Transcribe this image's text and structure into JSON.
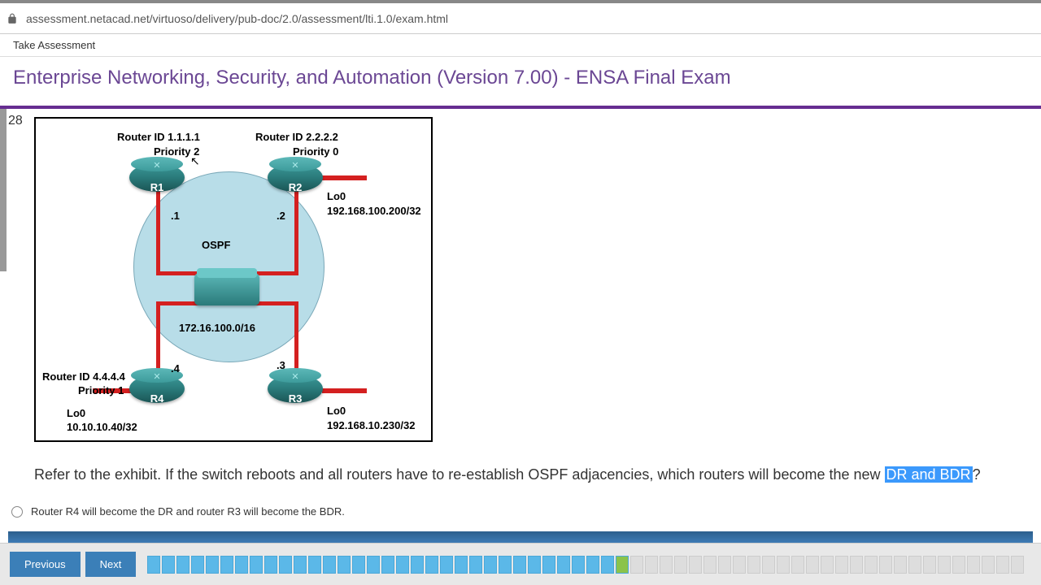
{
  "browser": {
    "url": "assessment.netacad.net/virtuoso/delivery/pub-doc/2.0/assessment/lti.1.0/exam.html"
  },
  "header": {
    "take_assessment": "Take Assessment",
    "exam_title": "Enterprise Networking, Security, and Automation (Version 7.00) - ENSA Final Exam"
  },
  "question": {
    "number": "28",
    "text_before": "Refer to the exhibit. If the switch reboots and all routers have to re-establish OSPF adjacencies, which routers will become the new ",
    "highlighted": "DR and BDR",
    "text_after": "?",
    "option1": "Router R4 will become the DR and router R3 will become the BDR."
  },
  "diagram": {
    "r1_id": "Router ID 1.1.1.1",
    "r1_priority": "Priority 2",
    "r1_label": "R1",
    "r1_dot": ".1",
    "r2_id": "Router ID 2.2.2.2",
    "r2_priority": "Priority 0",
    "r2_label": "R2",
    "r2_dot": ".2",
    "r2_lo": "Lo0",
    "r2_lo_ip": "192.168.100.200/32",
    "r3_label": "R3",
    "r3_dot": ".3",
    "r3_lo": "Lo0",
    "r3_lo_ip": "192.168.10.230/32",
    "r4_id": "Router ID 4.4.4.4",
    "r4_priority": "Priority 1",
    "r4_label": "R4",
    "r4_dot": ".4",
    "r4_lo": "Lo0",
    "r4_lo_ip": "10.10.10.40/32",
    "ospf": "OSPF",
    "subnet": "172.16.100.0/16"
  },
  "footer": {
    "previous": "Previous",
    "next": "Next"
  },
  "progress": {
    "total": 60,
    "completed": 32,
    "current": 33
  }
}
